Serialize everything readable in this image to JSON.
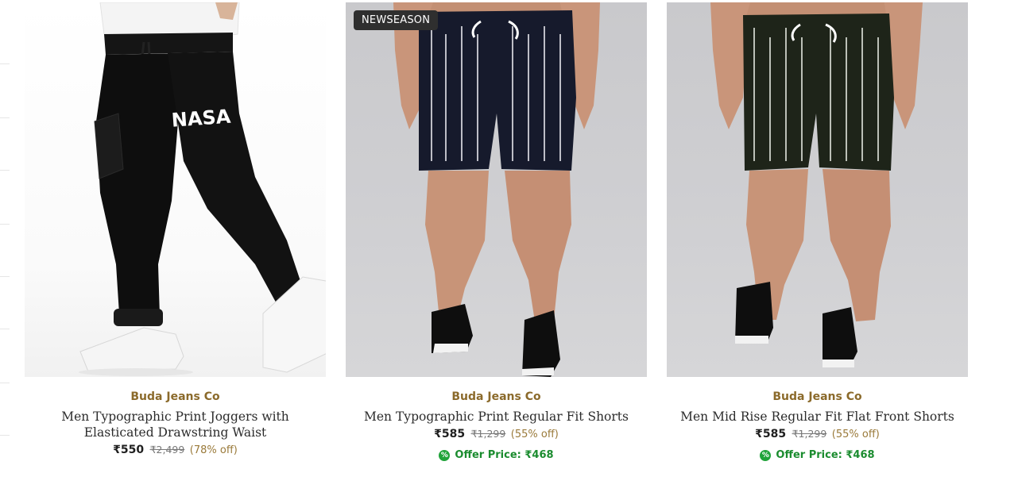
{
  "products": [
    {
      "brand": "Buda Jeans Co",
      "title": "Men Typographic Print Joggers with Elasticated Drawstring Waist",
      "price": "₹550",
      "mrp": "₹2,499",
      "discount": "(78% off)",
      "image_desc": "black-nasa-joggers"
    },
    {
      "badge": "NEWSEASON",
      "brand": "Buda Jeans Co",
      "title": "Men Typographic Print Regular Fit Shorts",
      "price": "₹585",
      "mrp": "₹1,299",
      "discount": "(55% off)",
      "offer": "Offer Price: ₹468",
      "image_desc": "navy-printed-shorts"
    },
    {
      "brand": "Buda Jeans Co",
      "title": "Men Mid Rise Regular Fit Flat Front Shorts",
      "price": "₹585",
      "mrp": "₹1,299",
      "discount": "(55% off)",
      "offer": "Offer Price: ₹468",
      "image_desc": "olive-printed-shorts"
    }
  ],
  "offer_icon": "%",
  "joggers_logo": "NASA",
  "colors": {
    "brand": "#8b6a2b",
    "discount": "#9a7a3a",
    "offer": "#1b8c2f",
    "badge_bg": "#2f2f2f"
  }
}
